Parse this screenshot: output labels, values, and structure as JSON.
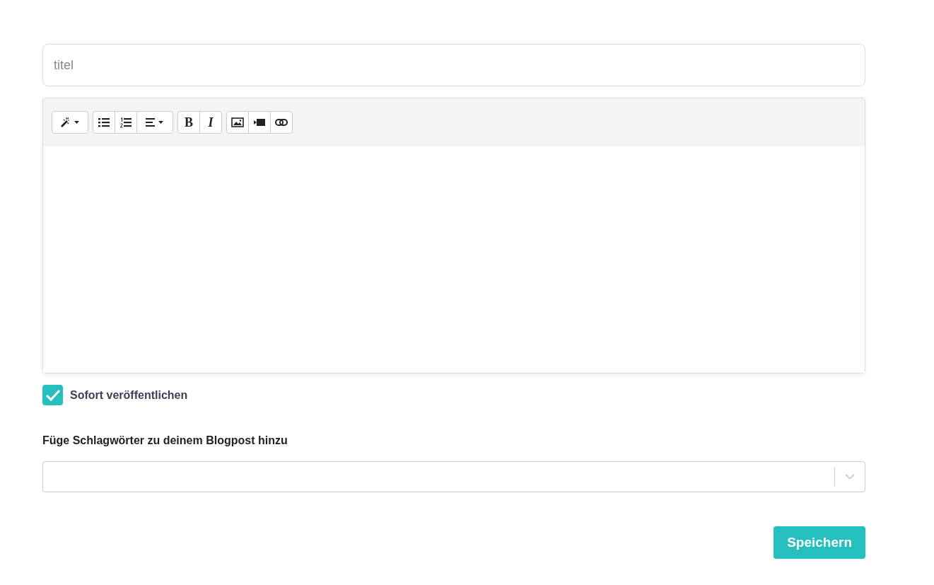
{
  "title_field": {
    "placeholder": "titel"
  },
  "toolbar": {
    "groups": [
      {
        "buttons": [
          {
            "kind": "style"
          }
        ]
      },
      {
        "buttons": [
          {
            "kind": "unordered-list"
          },
          {
            "kind": "ordered-list"
          },
          {
            "kind": "align"
          }
        ]
      },
      {
        "buttons": [
          {
            "kind": "bold",
            "label": "B"
          },
          {
            "kind": "italic",
            "label": "I"
          }
        ]
      },
      {
        "buttons": [
          {
            "kind": "picture"
          },
          {
            "kind": "video"
          },
          {
            "kind": "link"
          }
        ]
      }
    ]
  },
  "publish": {
    "label": "Sofort veröffentlichen",
    "checked": true
  },
  "tags": {
    "label": "Füge Schlagwörter zu deinem Blogpost hinzu"
  },
  "save_button": {
    "label": "Speichern"
  }
}
